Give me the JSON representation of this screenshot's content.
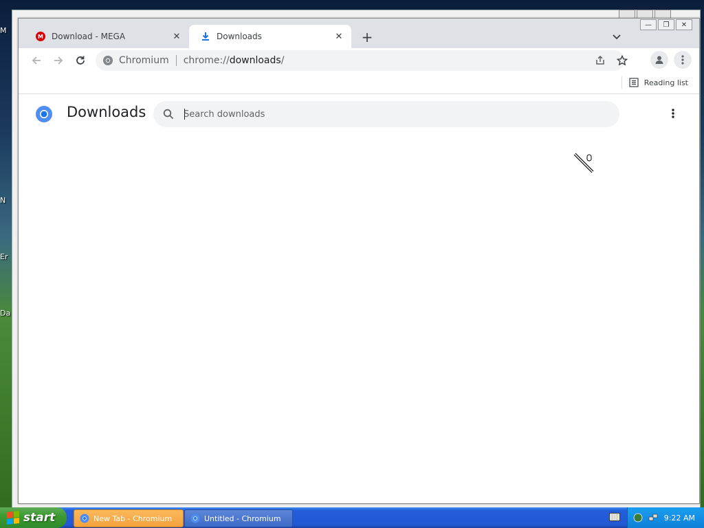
{
  "desktop": {
    "icon_labels": [
      "M",
      "N",
      "Er",
      "Da"
    ]
  },
  "browser": {
    "tabs": [
      {
        "title": "Download - MEGA",
        "active": false,
        "icon": "mega-icon"
      },
      {
        "title": "Downloads",
        "active": true,
        "icon": "download-icon"
      }
    ],
    "omnibox": {
      "site_label": "Chromium",
      "url_scheme": "chrome://",
      "url_host": "downloads",
      "url_suffix": "/"
    },
    "bookmarks_bar": {
      "reading_list_label": "Reading list"
    }
  },
  "downloads_page": {
    "title": "Downloads",
    "search_placeholder": "Search downloads",
    "search_value": ""
  },
  "taskbar": {
    "start_label": "start",
    "tasks": [
      {
        "label": "New Tab - Chromium",
        "active": true
      },
      {
        "label": "Untitled - Chromium",
        "active": false
      }
    ],
    "clock": "9:22 AM"
  },
  "colors": {
    "chrome_frame": "#dee1e6",
    "omnibox_bg": "#f1f3f4",
    "chromium_blue": "#1a73e8",
    "taskbar_blue": "#245edb",
    "start_green": "#3c9b32"
  }
}
